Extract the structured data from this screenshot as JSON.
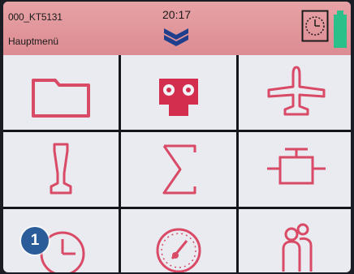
{
  "header": {
    "model_name": "000_KT5131",
    "menu_title": "Hauptmenü",
    "time": "20:17"
  },
  "badge": {
    "number": "1"
  },
  "menu_icons": [
    "folder-icon",
    "transmitter-icon",
    "airplane-icon",
    "probe-icon",
    "sum-icon",
    "servo-icon",
    "clock-icon",
    "speedometer-icon",
    "users-icon"
  ],
  "colors": {
    "header_bg": "#dc8c92",
    "icon": "#d94a66",
    "icon_fill": "#d42e4f",
    "grid_lines": "#15151c",
    "battery": "#2bbf8a",
    "badge": "#2b5c9a"
  }
}
